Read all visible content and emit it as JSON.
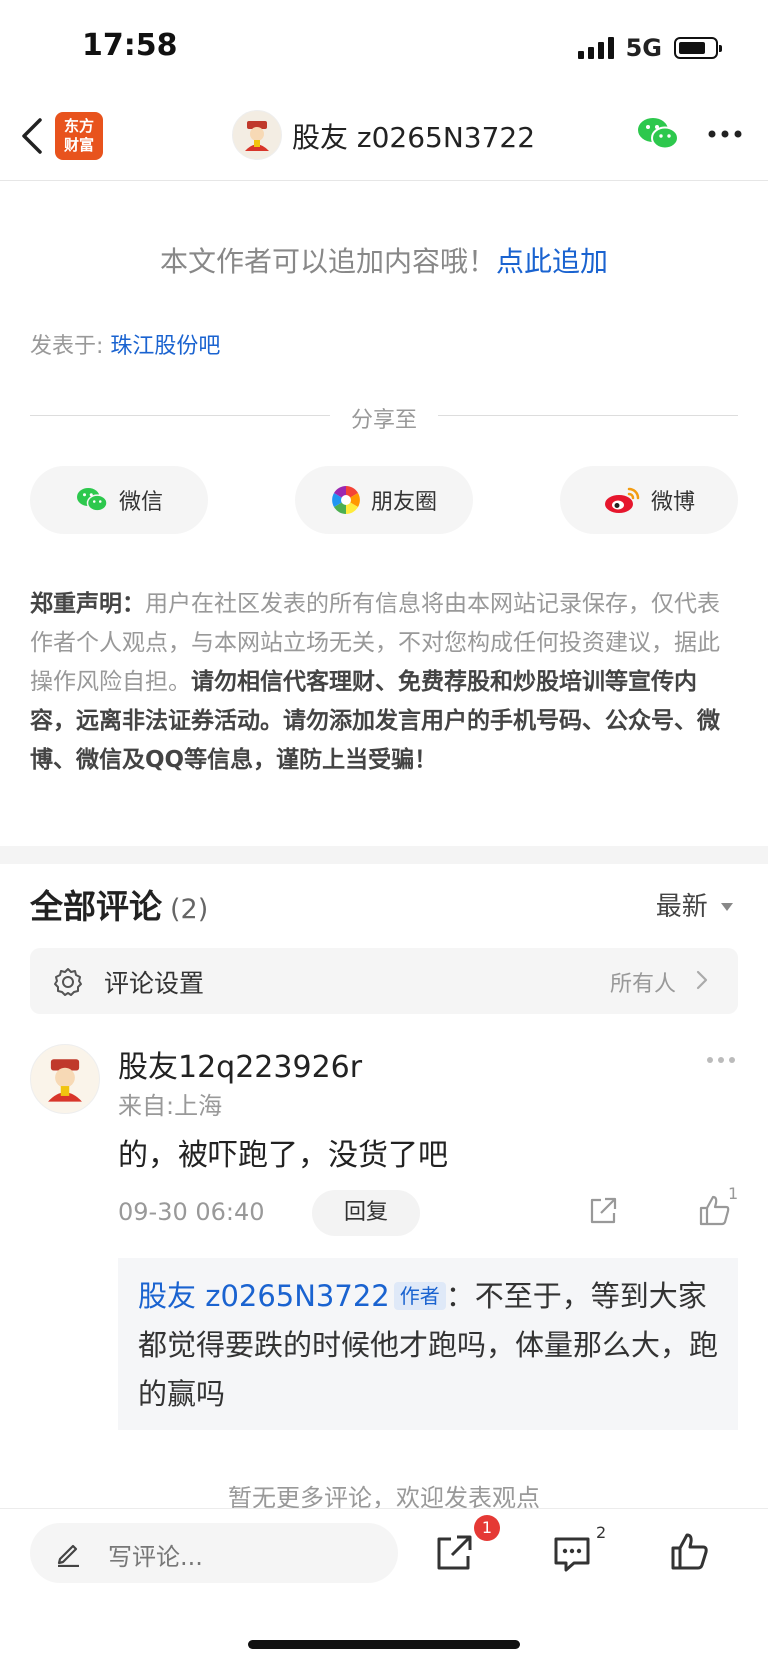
{
  "status_bar": {
    "time": "17:58",
    "network": "5G"
  },
  "nav": {
    "logo_line1": "东方",
    "logo_line2": "财富",
    "title": "股友 z0265N3722"
  },
  "append": {
    "text": "本文作者可以追加内容哦！",
    "link": "点此追加"
  },
  "posted": {
    "label": "发表于: ",
    "forum": "珠江股份吧"
  },
  "share": {
    "label": "分享至",
    "buttons": [
      "微信",
      "朋友圈",
      "微博"
    ]
  },
  "disclaimer": {
    "title": "郑重声明：",
    "body": "用户在社区发表的所有信息将由本网站记录保存，仅代表作者个人观点，与本网站立场无关，不对您构成任何投资建议，据此操作风险自担。",
    "warning": "请勿相信代客理财、免费荐股和炒股培训等宣传内容，远离非法证券活动。请勿添加发言用户的手机号码、公众号、微博、微信及QQ等信息，谨防上当受骗！"
  },
  "comments": {
    "title": "全部评论",
    "count": "(2)",
    "sort": "最新",
    "settings_label": "评论设置",
    "settings_value": "所有人",
    "items": [
      {
        "user": "股友12q223926r",
        "location": "来自:上海",
        "text": "的，被吓跑了，没货了吧",
        "time": "09-30 06:40",
        "reply_label": "回复",
        "likes": "1",
        "reply": {
          "user": "股友 z0265N3722",
          "tag": "作者",
          "text": "：不至于，等到大家都觉得要跌的时候他才跑吗，体量那么大，跑的赢吗"
        }
      }
    ],
    "no_more": "暂无更多评论，欢迎发表观点"
  },
  "bottom_bar": {
    "write_placeholder": "写评论...",
    "share_badge": "1",
    "comment_count": "2"
  },
  "colors": {
    "link": "#1a63d0",
    "brand": "#e8531d",
    "badge": "#e53935"
  }
}
